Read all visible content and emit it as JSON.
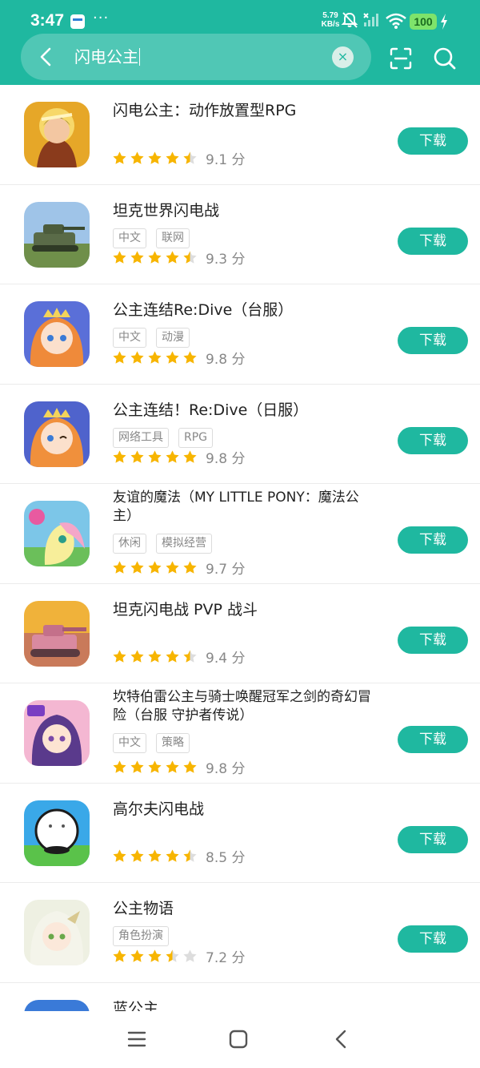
{
  "status_bar": {
    "time": "3:47",
    "dots": "···",
    "speed_value": "5.79",
    "speed_unit": "KB/s",
    "battery": "100"
  },
  "search": {
    "query": "闪电公主",
    "clear_symbol": "×"
  },
  "colors": {
    "accent": "#1fb8a0",
    "star_filled": "#f7b500",
    "star_empty": "#dddddd"
  },
  "apps": [
    {
      "title": "闪电公主：动作放置型RPG",
      "tags": [],
      "rating": 4.5,
      "score": "9.1 分",
      "button": "下载",
      "icon": "fantasy-warrior-icon"
    },
    {
      "title": "坦克世界闪电战",
      "tags": [
        "中文",
        "联网"
      ],
      "rating": 4.5,
      "score": "9.3 分",
      "button": "下载",
      "icon": "tank-icon"
    },
    {
      "title": "公主连结Re:Dive（台服）",
      "tags": [
        "中文",
        "动漫"
      ],
      "rating": 5,
      "score": "9.8 分",
      "button": "下载",
      "icon": "anime-princess-icon"
    },
    {
      "title": "公主连结！Re:Dive（日服）",
      "tags": [
        "网络工具",
        "RPG"
      ],
      "rating": 5,
      "score": "9.8 分",
      "button": "下载",
      "icon": "anime-princess-icon"
    },
    {
      "title": "友谊的魔法（MY LITTLE PONY：魔法公主）",
      "tags": [
        "休闲",
        "模拟经营"
      ],
      "rating": 5,
      "score": "9.7 分",
      "button": "下载",
      "icon": "pony-icon"
    },
    {
      "title": "坦克闪电战 PVP 战斗",
      "tags": [],
      "rating": 4.5,
      "score": "9.4 分",
      "button": "下载",
      "icon": "battle-tank-icon"
    },
    {
      "title": "坎特伯雷公主与骑士唤醒冠军之剑的奇幻冒险（台服 守护者传说）",
      "tags": [
        "中文",
        "策略"
      ],
      "rating": 5,
      "score": "9.8 分",
      "button": "下载",
      "icon": "guardian-girl-icon"
    },
    {
      "title": "高尔夫闪电战",
      "tags": [],
      "rating": 4.5,
      "score": "8.5 分",
      "button": "下载",
      "icon": "golf-ball-icon"
    },
    {
      "title": "公主物语",
      "tags": [
        "角色扮演"
      ],
      "rating": 3.5,
      "score": "7.2 分",
      "button": "下载",
      "icon": "elf-girl-icon"
    }
  ],
  "partial_app": {
    "title": "蓝公主",
    "icon": "blue-princess-icon"
  }
}
